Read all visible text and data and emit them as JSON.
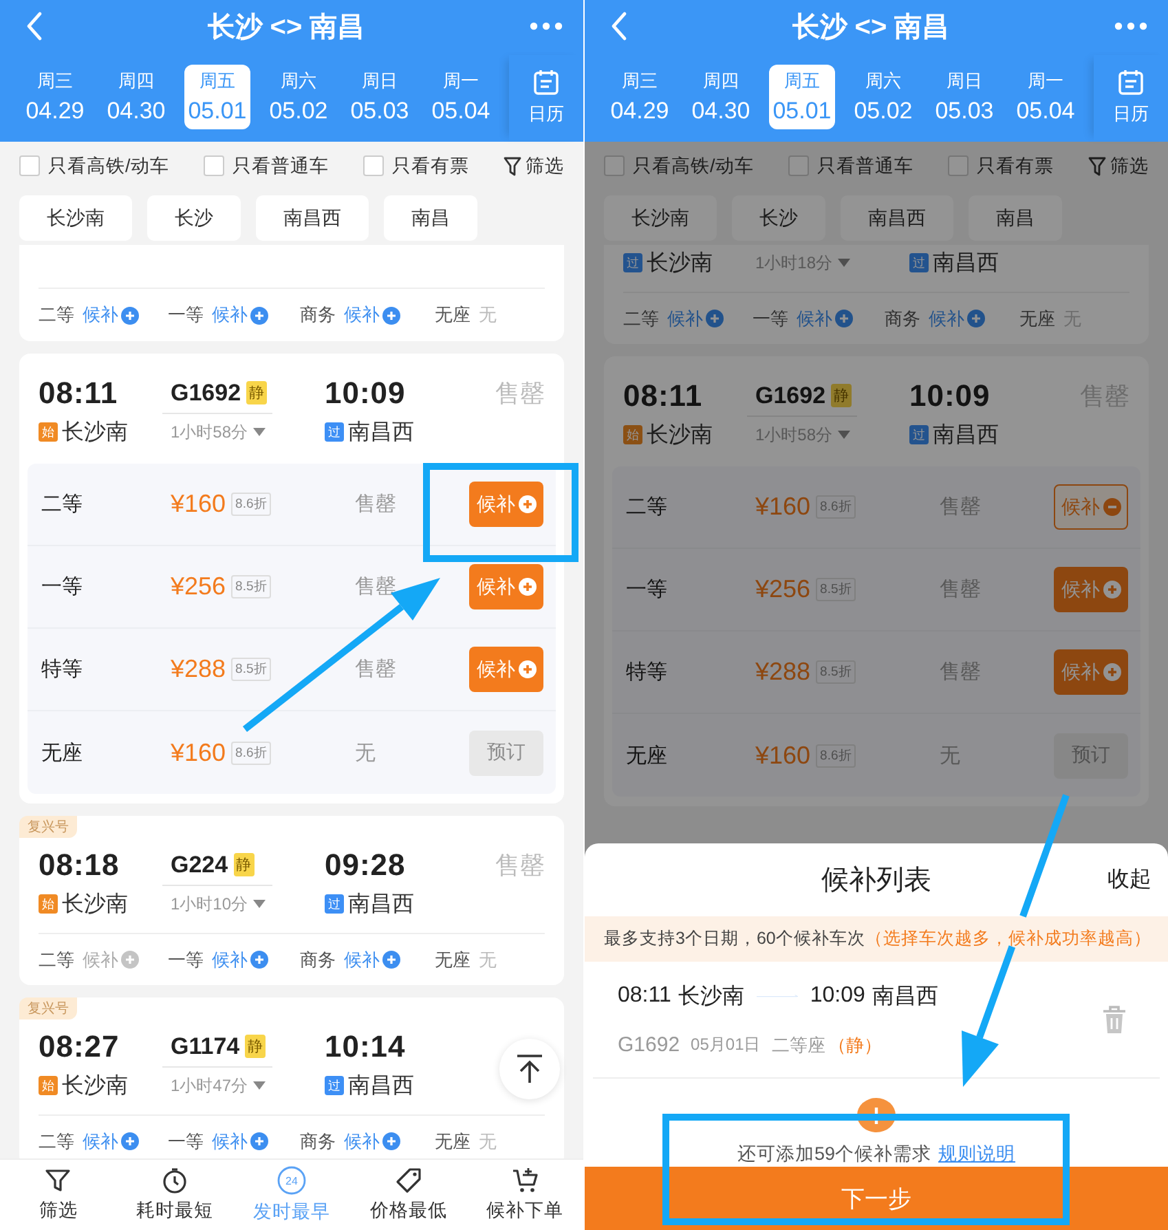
{
  "screens": [
    {
      "header": {
        "title": "长沙 <> 南昌",
        "dates": [
          {
            "day": "周三",
            "date": "04.29",
            "selected": false
          },
          {
            "day": "周四",
            "date": "04.30",
            "selected": false
          },
          {
            "day": "周五",
            "date": "05.01",
            "selected": true
          },
          {
            "day": "周六",
            "date": "05.02",
            "selected": false
          },
          {
            "day": "周日",
            "date": "05.03",
            "selected": false
          },
          {
            "day": "周一",
            "date": "05.04",
            "selected": false
          }
        ],
        "calendar": "日历"
      },
      "filters": [
        {
          "label": "只看高铁/动车",
          "checked": false
        },
        {
          "label": "只看普通车",
          "checked": false
        },
        {
          "label": "只看有票",
          "checked": false
        }
      ],
      "filter_button": "筛选",
      "stations": [
        {
          "label": "长沙南",
          "selected": false
        },
        {
          "label": "长沙",
          "selected": false
        },
        {
          "label": "南昌西",
          "selected": false
        },
        {
          "label": "南昌",
          "selected": false
        }
      ],
      "trains": [
        {
          "seat_summary": [
            {
              "class": "二等",
              "value": "候补",
              "kind": "waitlist"
            },
            {
              "class": "一等",
              "value": "候补",
              "kind": "waitlist"
            },
            {
              "class": "商务",
              "value": "候补",
              "kind": "waitlist"
            },
            {
              "class": "无座",
              "value": "无",
              "kind": "none"
            }
          ]
        },
        {
          "depart": "08:11",
          "number": "G1692",
          "quiet": "静",
          "arrive": "10:09",
          "status": "售罄",
          "stops": [
            {
              "tag": "始",
              "kind": "start",
              "name": "长沙南"
            },
            {
              "tag": "过",
              "kind": "pass",
              "name": "南昌西"
            }
          ],
          "duration": "1小时58分",
          "seats": [
            {
              "class": "二等",
              "price": "¥160",
              "discount": "8.6折",
              "availability": "售罄",
              "action": "候补",
              "kind": "waitlist",
              "selected": false
            },
            {
              "class": "一等",
              "price": "¥256",
              "discount": "8.5折",
              "availability": "售罄",
              "action": "候补",
              "kind": "waitlist",
              "selected": false
            },
            {
              "class": "特等",
              "price": "¥288",
              "discount": "8.5折",
              "availability": "售罄",
              "action": "候补",
              "kind": "waitlist",
              "selected": false
            },
            {
              "class": "无座",
              "price": "¥160",
              "discount": "8.6折",
              "availability": "无",
              "action": "预订",
              "kind": "book"
            }
          ]
        },
        {
          "badge": "复兴号",
          "depart": "08:18",
          "number": "G224",
          "quiet": "静",
          "arrive": "09:28",
          "status": "售罄",
          "stops": [
            {
              "tag": "始",
              "kind": "start",
              "name": "长沙南"
            },
            {
              "tag": "过",
              "kind": "pass",
              "name": "南昌西"
            }
          ],
          "duration": "1小时10分",
          "seat_summary": [
            {
              "class": "二等",
              "value": "候补",
              "kind": "waitlist_off"
            },
            {
              "class": "一等",
              "value": "候补",
              "kind": "waitlist"
            },
            {
              "class": "商务",
              "value": "候补",
              "kind": "waitlist"
            },
            {
              "class": "无座",
              "value": "无",
              "kind": "none"
            }
          ]
        },
        {
          "badge": "复兴号",
          "depart": "08:27",
          "number": "G1174",
          "quiet": "静",
          "arrive": "10:14",
          "stops": [
            {
              "tag": "始",
              "kind": "start",
              "name": "长沙南"
            },
            {
              "tag": "过",
              "kind": "pass",
              "name": "南昌西"
            }
          ],
          "duration": "1小时47分",
          "seat_summary": [
            {
              "class": "二等",
              "value": "候补",
              "kind": "waitlist"
            },
            {
              "class": "一等",
              "value": "候补",
              "kind": "waitlist"
            },
            {
              "class": "商务",
              "value": "候补",
              "kind": "waitlist"
            },
            {
              "class": "无座",
              "value": "无",
              "kind": "none"
            }
          ]
        }
      ],
      "scroll_top": true,
      "tabs": [
        {
          "label": "筛选",
          "kind": "filter",
          "selected": false
        },
        {
          "label": "耗时最短",
          "kind": "timer",
          "selected": false
        },
        {
          "label": "发时最早",
          "kind": "clock",
          "icon_text": "24",
          "selected": true
        },
        {
          "label": "价格最低",
          "kind": "price",
          "selected": false
        },
        {
          "label": "候补下单",
          "kind": "cart",
          "selected": false
        }
      ]
    },
    {
      "header": {
        "title": "长沙 <> 南昌",
        "dates": [
          {
            "day": "周三",
            "date": "04.29",
            "selected": false
          },
          {
            "day": "周四",
            "date": "04.30",
            "selected": false
          },
          {
            "day": "周五",
            "date": "05.01",
            "selected": true
          },
          {
            "day": "周六",
            "date": "05.02",
            "selected": false
          },
          {
            "day": "周日",
            "date": "05.03",
            "selected": false
          },
          {
            "day": "周一",
            "date": "05.04",
            "selected": false
          }
        ],
        "calendar": "日历"
      },
      "filters": [
        {
          "label": "只看高铁/动车",
          "checked": false
        },
        {
          "label": "只看普通车",
          "checked": false
        },
        {
          "label": "只看有票",
          "checked": false
        }
      ],
      "filter_button": "筛选",
      "stations": [
        {
          "label": "长沙南",
          "selected": false
        },
        {
          "label": "长沙",
          "selected": false
        },
        {
          "label": "南昌西",
          "selected": false
        },
        {
          "label": "南昌",
          "selected": false
        }
      ],
      "trains": [
        {
          "stops": [
            {
              "tag": "过",
              "kind": "pass",
              "name": "长沙南"
            },
            {
              "tag": "过",
              "kind": "pass",
              "name": "南昌西"
            }
          ],
          "duration": "1小时18分",
          "seat_summary": [
            {
              "class": "二等",
              "value": "候补",
              "kind": "waitlist"
            },
            {
              "class": "一等",
              "value": "候补",
              "kind": "waitlist"
            },
            {
              "class": "商务",
              "value": "候补",
              "kind": "waitlist"
            },
            {
              "class": "无座",
              "value": "无",
              "kind": "none"
            }
          ]
        },
        {
          "depart": "08:11",
          "number": "G1692",
          "quiet": "静",
          "arrive": "10:09",
          "status": "售罄",
          "stops": [
            {
              "tag": "始",
              "kind": "start",
              "name": "长沙南"
            },
            {
              "tag": "过",
              "kind": "pass",
              "name": "南昌西"
            }
          ],
          "duration": "1小时58分",
          "seats": [
            {
              "class": "二等",
              "price": "¥160",
              "discount": "8.6折",
              "availability": "售罄",
              "action": "候补",
              "kind": "waitlist",
              "selected": true
            },
            {
              "class": "一等",
              "price": "¥256",
              "discount": "8.5折",
              "availability": "售罄",
              "action": "候补",
              "kind": "waitlist",
              "selected": false
            },
            {
              "class": "特等",
              "price": "¥288",
              "discount": "8.5折",
              "availability": "售罄",
              "action": "候补",
              "kind": "waitlist",
              "selected": false
            },
            {
              "class": "无座",
              "price": "¥160",
              "discount": "8.6折",
              "availability": "无",
              "action": "预订",
              "kind": "book"
            }
          ]
        }
      ],
      "dimmed": true,
      "sheet": {
        "title": "候补列表",
        "close": "收起",
        "notice": "最多支持3个日期，60个候补车次",
        "notice_highlight": "（选择车次越多，候补成功率越高）",
        "entries": [
          {
            "depart": "08:11",
            "from": "长沙南",
            "arrive": "10:09",
            "to": "南昌西",
            "number": "G1692",
            "date": "05月01日",
            "seat": "二等座",
            "note": "（静）"
          }
        ],
        "remaining": "还可添加59个候补需求",
        "rule_link": "规则说明",
        "next": "下一步"
      }
    }
  ]
}
